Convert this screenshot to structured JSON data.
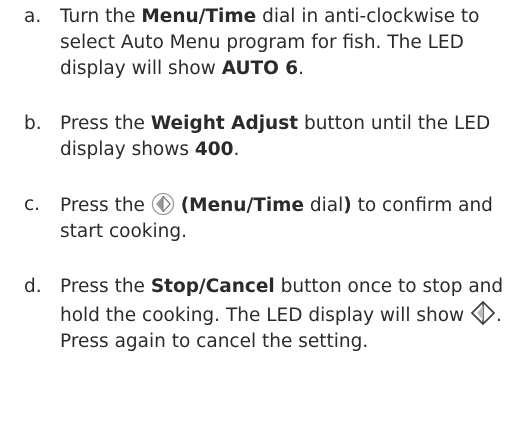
{
  "steps": [
    {
      "marker": "a.",
      "parts": {
        "t1": "Turn the ",
        "b1": "Menu/Time",
        "t2": " dial in anti-clockwise to select Auto Menu program for fish. The LED display will show ",
        "b2": "AUTO 6",
        "t3": "."
      }
    },
    {
      "marker": "b.",
      "parts": {
        "t1": "Press the ",
        "b1": "Weight Adjust",
        "t2": " button until the LED display shows ",
        "b2": "400",
        "t3": "."
      }
    },
    {
      "marker": "c.",
      "parts": {
        "t1": "Press the ",
        "b1": "(Menu/Time",
        "t2": " dial",
        "b2": ")",
        "t3": " to confirm and start cooking."
      }
    },
    {
      "marker": "d.",
      "parts": {
        "t1": "Press the ",
        "b1": "Stop/Cancel",
        "t2": " button once to stop and hold the cooking. The LED display will show ",
        "t3": ". Press again to cancel the setting."
      }
    }
  ],
  "icons": {
    "dial": "menu-time-dial-icon",
    "stop": "stop-cancel-icon"
  },
  "colors": {
    "text": "#2b2b2b",
    "icon_stroke": "#555555",
    "icon_fill": "#9a9a9a"
  }
}
